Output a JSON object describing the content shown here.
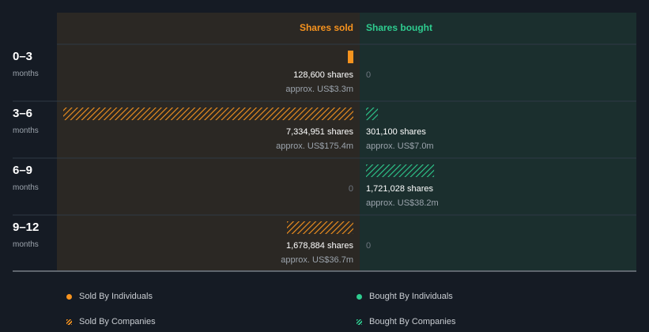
{
  "colors": {
    "background": "#151b24",
    "sold_panel": "#2b2824",
    "bought_panel": "#1b2f2e",
    "sold": "#f7931e",
    "bought": "#2ecc8f",
    "row_label": "#ffffff",
    "row_sublabel": "#9ba3ac",
    "value_text": "#ffffff",
    "approx_text": "#9ba3ac",
    "zero_text": "#6f7780",
    "divider": "#2f3a45"
  },
  "chart_data": {
    "type": "bar",
    "orientation": "horizontal-diverging",
    "columns": {
      "sold": "Shares sold",
      "bought": "Shares bought"
    },
    "rows": [
      {
        "label": "0–3",
        "sublabel": "months",
        "sold": {
          "shares": 128600,
          "shares_text": "128,600 shares",
          "approx_text": "approx. US$3.3m",
          "type": "individuals"
        },
        "bought": {
          "shares": 0,
          "shares_text": "0",
          "approx_text": "",
          "type": "none"
        }
      },
      {
        "label": "3–6",
        "sublabel": "months",
        "sold": {
          "shares": 7334951,
          "shares_text": "7,334,951 shares",
          "approx_text": "approx. US$175.4m",
          "type": "companies"
        },
        "bought": {
          "shares": 301100,
          "shares_text": "301,100 shares",
          "approx_text": "approx. US$7.0m",
          "type": "companies"
        }
      },
      {
        "label": "6–9",
        "sublabel": "months",
        "sold": {
          "shares": 0,
          "shares_text": "0",
          "approx_text": "",
          "type": "none"
        },
        "bought": {
          "shares": 1721028,
          "shares_text": "1,721,028 shares",
          "approx_text": "approx. US$38.2m",
          "type": "companies"
        }
      },
      {
        "label": "9–12",
        "sublabel": "months",
        "sold": {
          "shares": 1678884,
          "shares_text": "1,678,884 shares",
          "approx_text": "approx. US$36.7m",
          "type": "companies"
        },
        "bought": {
          "shares": 0,
          "shares_text": "0",
          "approx_text": "",
          "type": "none"
        }
      }
    ],
    "scale_max_shares": 7334951
  },
  "legend": {
    "sold_individuals": "Sold By Individuals",
    "bought_individuals": "Bought By Individuals",
    "sold_companies": "Sold By Companies",
    "bought_companies": "Bought By Companies"
  }
}
